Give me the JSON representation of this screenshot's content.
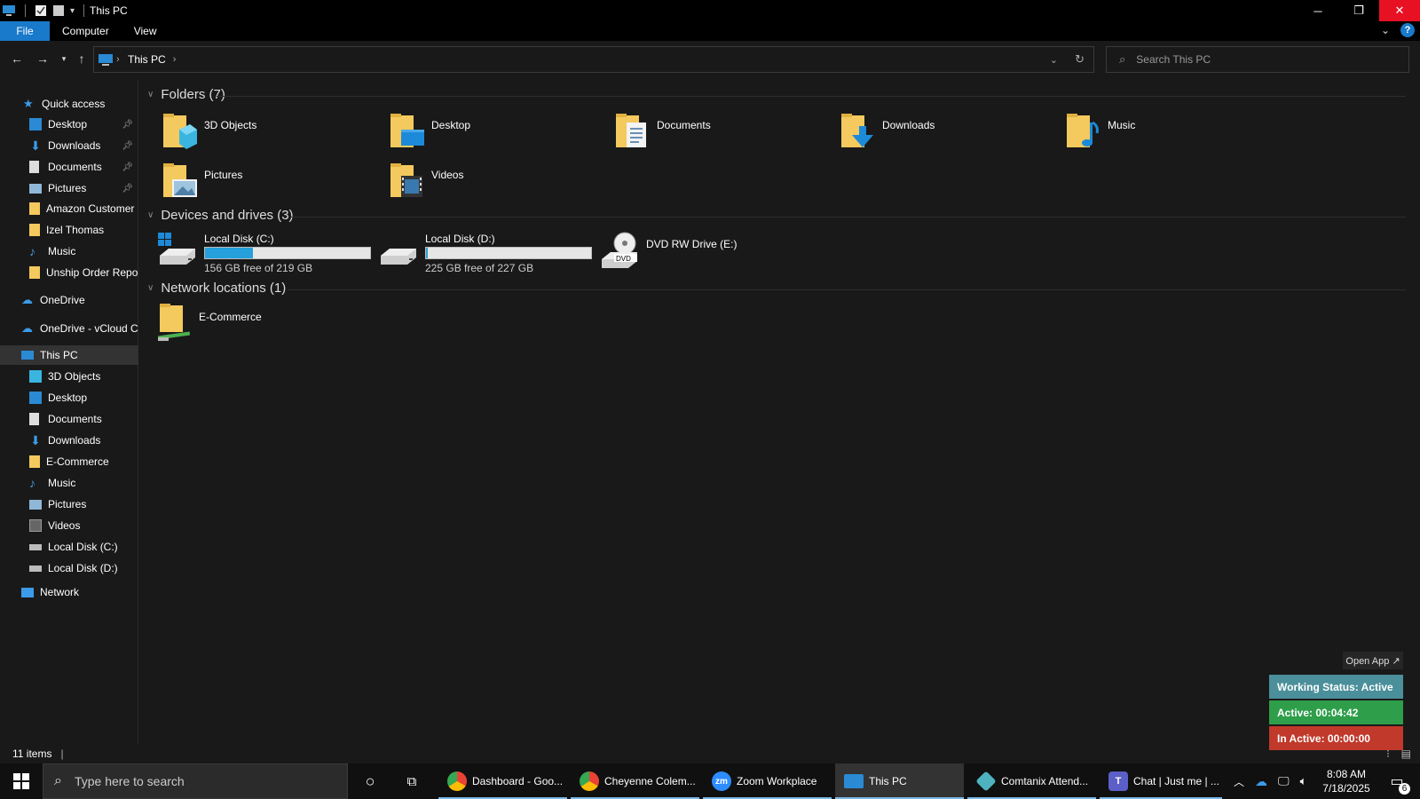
{
  "window": {
    "title": "This PC",
    "controls": {
      "minimize": "─",
      "maximize": "❐",
      "close": "✕"
    }
  },
  "ribbon": {
    "tabs": [
      "File",
      "Computer",
      "View"
    ]
  },
  "address": {
    "crumb": "This PC",
    "search_placeholder": "Search This PC"
  },
  "nav": {
    "quick_access": "Quick access",
    "quick_items": [
      "Desktop",
      "Downloads",
      "Documents",
      "Pictures",
      "Amazon Customer",
      "Izel Thomas",
      "Music",
      "Unship Order Report"
    ],
    "onedrive": "OneDrive",
    "onedrive_vcloud": "OneDrive - vCloud Cl",
    "this_pc": "This PC",
    "pc_items": [
      "3D Objects",
      "Desktop",
      "Documents",
      "Downloads",
      "E-Commerce",
      "Music",
      "Pictures",
      "Videos",
      "Local Disk (C:)",
      "Local Disk (D:)"
    ],
    "network": "Network"
  },
  "content": {
    "folders_header": "Folders (7)",
    "folders": [
      "3D Objects",
      "Desktop",
      "Documents",
      "Downloads",
      "Music",
      "Pictures",
      "Videos"
    ],
    "devices_header": "Devices and drives (3)",
    "drives": [
      {
        "name": "Local Disk (C:)",
        "free": "156 GB free of 219 GB",
        "used_fraction": 0.29
      },
      {
        "name": "Local Disk (D:)",
        "free": "225 GB free of 227 GB",
        "used_fraction": 0.01
      },
      {
        "name": "DVD RW Drive (E:)"
      }
    ],
    "dvd_label": "DVD",
    "network_header": "Network locations (1)",
    "network_items": [
      "E-Commerce"
    ]
  },
  "status": {
    "items": "11 items"
  },
  "widget": {
    "open_app": "Open App ↗",
    "working": "Working Status: Active",
    "active": "Active: 00:04:42",
    "inactive": "In Active: 00:00:00",
    "colors": {
      "working": "#4a8f9a",
      "active": "#2e9e4a",
      "inactive": "#c0392b"
    }
  },
  "taskbar": {
    "search_placeholder": "Type here to search",
    "apps": [
      "Dashboard - Goo...",
      "Cheyenne Colem...",
      "Zoom Workplace",
      "This PC",
      "Comtanix Attend...",
      "Chat | Just me | ..."
    ],
    "time": "8:08 AM",
    "date": "7/18/2025",
    "notif_count": "6"
  }
}
